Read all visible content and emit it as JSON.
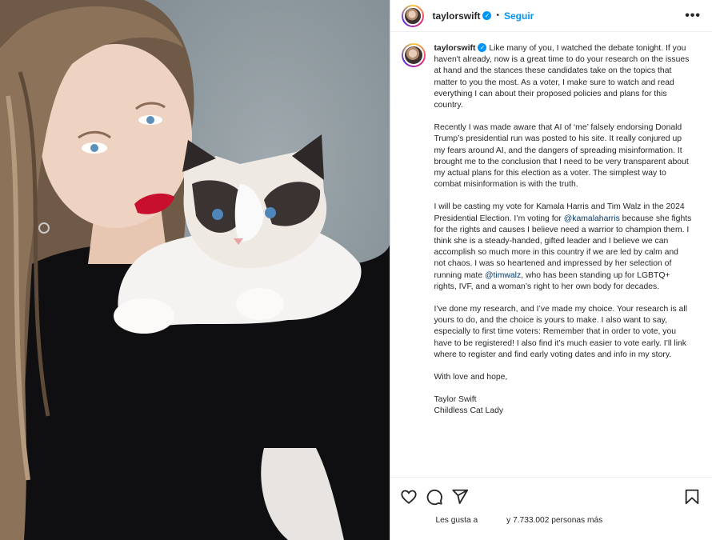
{
  "header": {
    "username": "taylorswift",
    "separator": "•",
    "follow_label": "Seguir",
    "more_label": "•••"
  },
  "caption": {
    "username": "taylorswift",
    "p1": "Like many of you, I watched the debate tonight. If you haven't already, now is a great time to do your research on the issues at hand and the stances these candidates take on the topics that matter to you the most. As a voter, I make sure to watch and read everything I can about their proposed policies and plans for this country.",
    "p2": "Recently I was made aware that AI of ‘me’ falsely endorsing Donald Trump’s presidential run was posted to his site. It really conjured up my fears around AI, and the dangers of spreading misinformation. It brought me to the conclusion that I need to be very transparent about my actual plans for this election as a voter. The simplest way to combat misinformation is with the truth.",
    "p3_a": "I will be casting my vote for Kamala Harris and Tim Walz in the 2024 Presidential Election. I’m voting for ",
    "p3_mention1": "@kamalaharris",
    "p3_b": " because she fights for the rights and causes I believe need a warrior to champion them. I think she is a steady-handed, gifted leader and I believe we can accomplish so much more in this country if we are led by calm and not chaos. I was so heartened and impressed by her selection of running mate ",
    "p3_mention2": "@timwalz",
    "p3_c": ", who has been standing up for LGBTQ+ rights, IVF, and a woman’s right to her own body for decades.",
    "p4": "I’ve done my research, and I’ve made my choice. Your research is all yours to do, and the choice is yours to make. I also want to say, especially to first time voters: Remember that in order to vote, you have to be registered! I also find it’s much easier to vote early. I’ll link where to register and find early voting dates and info in my story.",
    "p5": "With love and hope,",
    "sign1": "Taylor Swift",
    "sign2": "Childless Cat Lady"
  },
  "actions": {
    "icons": [
      "heart-icon",
      "comment-icon",
      "share-icon",
      "bookmark-icon"
    ]
  },
  "likes": {
    "prefix": "Les gusta a",
    "suffix": "y 7.733.002 personas más"
  },
  "colors": {
    "link": "#0095f6",
    "mention": "#00376b",
    "text": "#262626"
  }
}
